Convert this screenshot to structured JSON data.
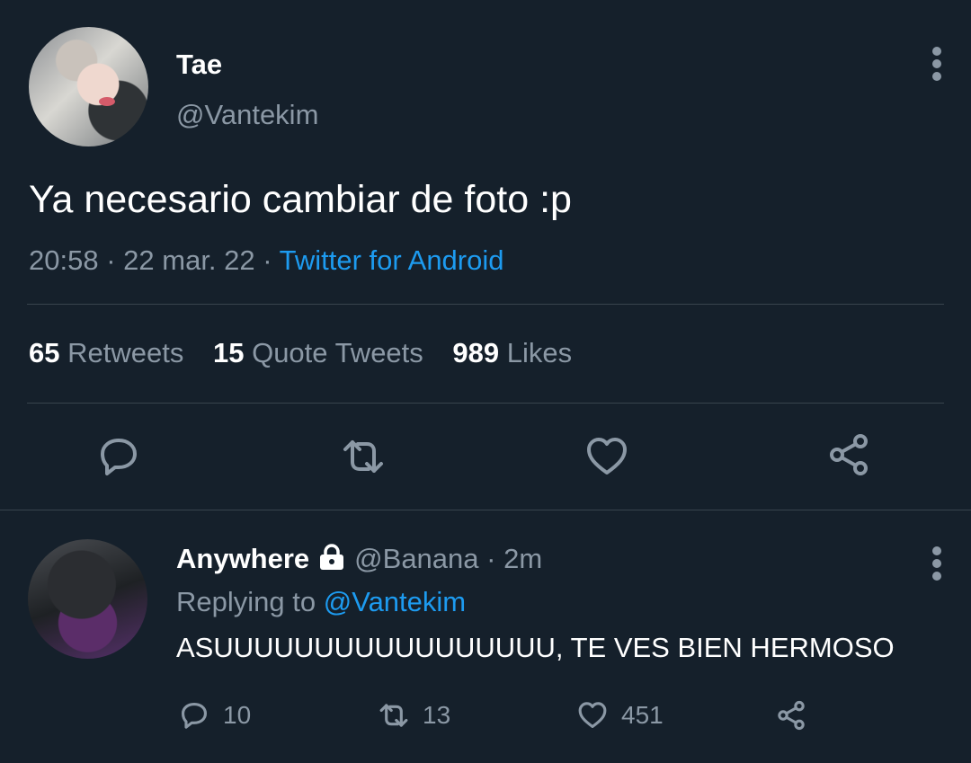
{
  "tweet": {
    "name": "Tae",
    "handle": "@Vantekim",
    "text": "Ya necesario cambiar de foto :p",
    "time": "20:58",
    "date": "22 mar. 22",
    "source": "Twitter for Android",
    "separator": "·",
    "stats": {
      "retweets_count": "65",
      "retweets_label": "Retweets",
      "quotes_count": "15",
      "quotes_label": "Quote Tweets",
      "likes_count": "989",
      "likes_label": "Likes"
    }
  },
  "reply": {
    "name": "Anywhere",
    "handle": "@Banana",
    "time": "2m",
    "separator": "·",
    "replying_prefix": "Replying to",
    "replying_to": "@Vantekim",
    "text": "ASUUUUUUUUUUUUUUUUU, TE VES BIEN HERMOSO",
    "actions": {
      "replies": "10",
      "retweets": "13",
      "likes": "451"
    }
  },
  "icons": {
    "more": "more-vertical-icon",
    "reply": "comment-icon",
    "retweet": "retweet-icon",
    "like": "heart-icon",
    "share": "share-icon",
    "protected": "lock-icon"
  },
  "colors": {
    "background": "#15202b",
    "text": "#ffffff",
    "secondary": "#8b98a5",
    "link": "#1d9bf0",
    "divider": "#38444d"
  }
}
